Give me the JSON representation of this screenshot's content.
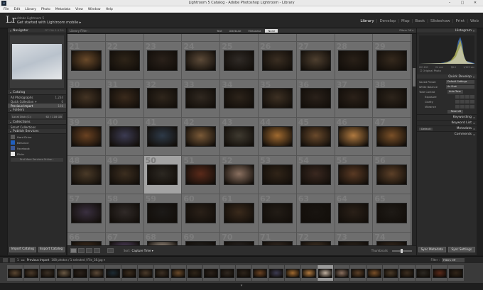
{
  "window": {
    "title": "Lightroom 5 Catalog - Adobe Photoshop Lightroom - Library",
    "icon_text": "Lr",
    "controls": [
      "–",
      "□",
      "✕"
    ]
  },
  "menu": [
    "File",
    "Edit",
    "Library",
    "Photo",
    "Metadata",
    "View",
    "Window",
    "Help"
  ],
  "identity": {
    "logo": "Lr",
    "user": "Adobe Lightroom 5",
    "get_started": "Get started with Lightroom mobile ▸",
    "modules": [
      "Library",
      "Develop",
      "Map",
      "Book",
      "Slideshow",
      "Print",
      "Web"
    ],
    "active_module": "Library",
    "separator": "|"
  },
  "left_panel": {
    "navigator": {
      "label": "Navigator",
      "options": "FIT  FILL  1:1  3:1"
    },
    "catalog": {
      "label": "Catalog",
      "items": [
        {
          "name": "All Photographs",
          "count": "1,234"
        },
        {
          "name": "Quick Collection +",
          "count": "0"
        },
        {
          "name": "Previous Import",
          "count": "108"
        }
      ]
    },
    "folders": {
      "label": "Folders",
      "volume": "Local Disk (C:)",
      "volume_info": "62 / 118 GB"
    },
    "collections": {
      "label": "Collections",
      "item": "Smart Collections"
    },
    "publish": {
      "label": "Publish Services",
      "items": [
        "Hard Drive",
        "Behance",
        "Facebook",
        "Flickr"
      ],
      "find_more": "Find More Services Online..."
    },
    "buttons": {
      "import": "Import Catalog",
      "export": "Export Catalog"
    }
  },
  "filter_bar": {
    "label": "Library Filter :",
    "tabs": [
      "Text",
      "Attribute",
      "Metadata",
      "None"
    ],
    "active": "None",
    "right": "Filters Off ▾"
  },
  "grid": {
    "numbers": [
      12,
      13,
      14,
      15,
      16,
      17,
      18,
      19,
      20,
      21,
      22,
      23,
      24,
      25,
      26,
      27,
      28,
      29,
      30,
      31,
      32,
      33,
      34,
      35,
      36,
      37,
      38,
      39,
      40,
      41,
      42,
      43,
      44,
      45,
      46,
      47,
      48,
      49,
      50,
      51,
      52,
      53,
      54,
      55,
      56,
      57,
      58,
      59,
      60,
      61,
      62,
      63,
      64,
      65,
      66,
      67,
      68,
      69,
      70,
      71,
      72,
      73,
      74
    ],
    "colors": [
      "#5a4631",
      "#4a3a2a",
      "#3b3025",
      "#6b5a45",
      "#1c2a33",
      "#3a2c1e",
      "#2a2420",
      "#4b3b2b",
      "#3c3024",
      "#6a4a2a",
      "#2e2418",
      "#2a211a",
      "#5c4a38",
      "#2f2a26",
      "#3a2e22",
      "#4e3f2f",
      "#292018",
      "#35291d",
      "#443424",
      "#3a2a1c",
      "#2f261c",
      "#302820",
      "#2c231a",
      "#3d3023",
      "#2a211a",
      "#2b2119",
      "#2d241b",
      "#6a4222",
      "#3c3b52",
      "#2e3a48",
      "#7a5a38",
      "#3f3a30",
      "#a06a30",
      "#6a4a2c",
      "#b07a40",
      "#7a5028",
      "#4a3a28",
      "#3c2e20",
      "#2c2822",
      "#5a2a1a",
      "#8a7060",
      "#302418",
      "#3a2820",
      "#5a3a24",
      "#5c4028",
      "#3a3040",
      "#302a28",
      "#1c1a18",
      "#2a2018",
      "#3a2a1c",
      "#221c16",
      "#181410",
      "#2a2018",
      "#1e1a16",
      "#443020",
      "#5c4a70",
      "#c0b0a0",
      "#22201e",
      "#2a2624",
      "#3a2e26",
      "#4a3a2a",
      "#2e261e",
      "#3a2c20"
    ],
    "selected_index": 38
  },
  "toolbar": {
    "sort_label": "Sort:",
    "sort_value": "Capture Time ▾",
    "thumbnails": "Thumbnails"
  },
  "right_panel": {
    "histogram": {
      "label": "Histogram",
      "meta": [
        "ISO 400",
        "24 mm",
        "f/8.0",
        "1/125 sec"
      ],
      "original": "Original Photo"
    },
    "quick_develop": {
      "label": "Quick Develop",
      "saved_preset_label": "Saved Preset",
      "saved_preset_value": "Default Settings",
      "white_balance_label": "White Balance",
      "white_balance_value": "As Shot",
      "tone_control_label": "Tone Control",
      "tone_control_value": "Auto Tone",
      "rows": [
        "Exposure",
        "Clarity",
        "Vibrance"
      ],
      "reset": "Reset All"
    },
    "collapsed": [
      "Keywording",
      "Keyword List",
      "Metadata",
      "Comments"
    ],
    "metadata_default": "Default",
    "buttons": {
      "sync": "Sync Metadata",
      "sync_settings": "Sync Settings"
    }
  },
  "filmstrip": {
    "page_label": "1",
    "nav": "◂ ▸",
    "source": "Previous Import",
    "count": "108 photos / 1 selected / File_38.jpg ▾",
    "filter_label": "Filter :",
    "filter_value": "Filters Off",
    "colors": [
      "#5a4631",
      "#4a3a2a",
      "#3b3025",
      "#6b5a45",
      "#2a211a",
      "#5c4a38",
      "#1c2a33",
      "#3a2c1e",
      "#4b3b2b",
      "#3c3024",
      "#6a4a2a",
      "#2e2418",
      "#2a211a",
      "#302820",
      "#2c231a",
      "#6a4222",
      "#3c3b52",
      "#a06a30",
      "#b07a40",
      "#c0b0a0",
      "#8a7060",
      "#5c4028",
      "#7a5028",
      "#4a3a28",
      "#3c2e20",
      "#2c2822",
      "#5a2a1a",
      "#302418"
    ],
    "selected_index": 19
  }
}
